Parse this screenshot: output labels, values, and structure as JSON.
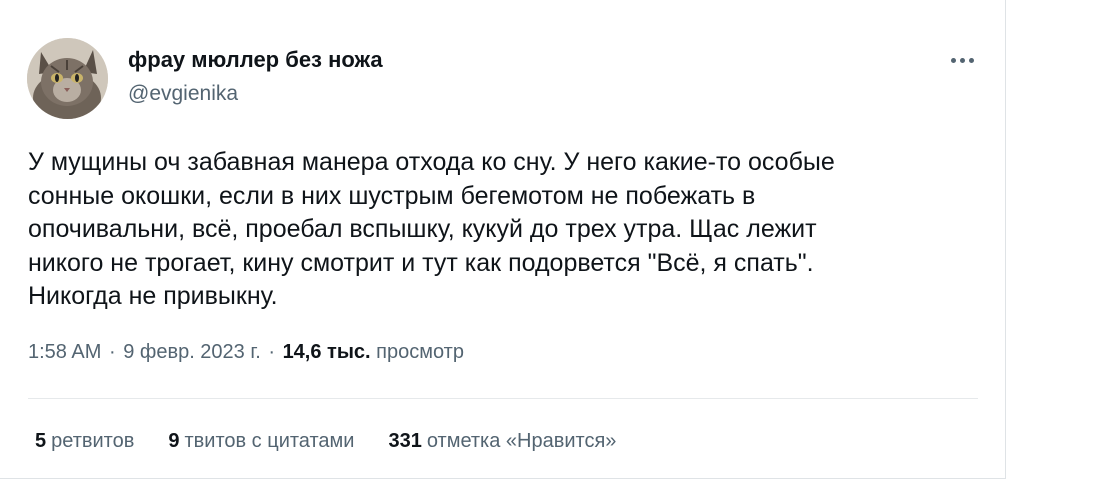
{
  "author": {
    "display_name": "фрау мюллер без ножа",
    "handle": "@evgienika"
  },
  "tweet": {
    "lines": [
      "У мущины оч забавная манера отхода ко сну. У него какие-то особые",
      "сонные окошки, если в них шустрым бегемотом не побежать в",
      "опочивальни, всё, проебал вспышку, кукуй до трех утра. Щас лежит",
      "никого не трогает, кину смотрит и тут как подорвется \"Всё, я спать\".",
      "Никогда не привыкну."
    ]
  },
  "meta": {
    "time": "1:58 AM",
    "date": "9 февр. 2023 г.",
    "views_count": "14,6 тыс.",
    "views_label": "просмотр",
    "separator": "·"
  },
  "stats": {
    "retweets": {
      "count": "5",
      "label": "ретвитов"
    },
    "quotes": {
      "count": "9",
      "label": "твитов с цитатами"
    },
    "likes": {
      "count": "331",
      "label": "отметка «Нравится»"
    }
  },
  "icons": {
    "more": "more-options-icon"
  },
  "colors": {
    "text_primary": "#0f1419",
    "text_secondary": "#536471",
    "divider": "#e6e9eb"
  }
}
